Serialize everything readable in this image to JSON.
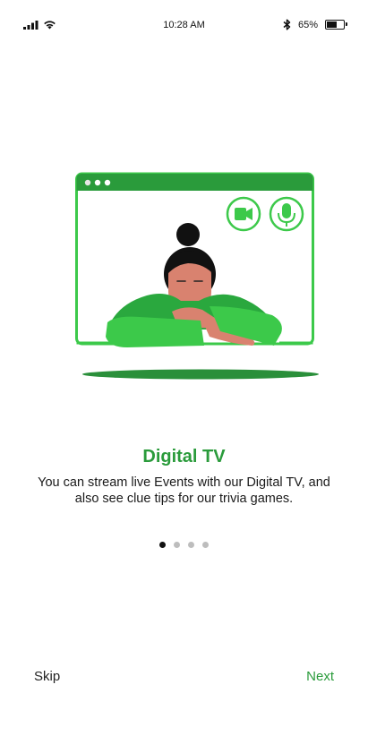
{
  "status_bar": {
    "time": "10:28 AM",
    "battery_text": "65%",
    "battery_level": 0.65,
    "icons": [
      "signal-icon",
      "wifi-icon",
      "bluetooth-icon",
      "battery-icon"
    ]
  },
  "onboarding": {
    "title": "Digital TV",
    "description": "You can stream live Events with our Digital TV, and also see clue tips for our trivia games.",
    "pages_total": 4,
    "current_page": 1
  },
  "nav": {
    "skip_label": "Skip",
    "next_label": "Next"
  },
  "colors": {
    "accent": "#2a9b3b",
    "illustration_green": "#3cc94a",
    "skin": "#d9826f",
    "dot_active": "#111111",
    "dot_inactive": "#bdbdbd"
  }
}
